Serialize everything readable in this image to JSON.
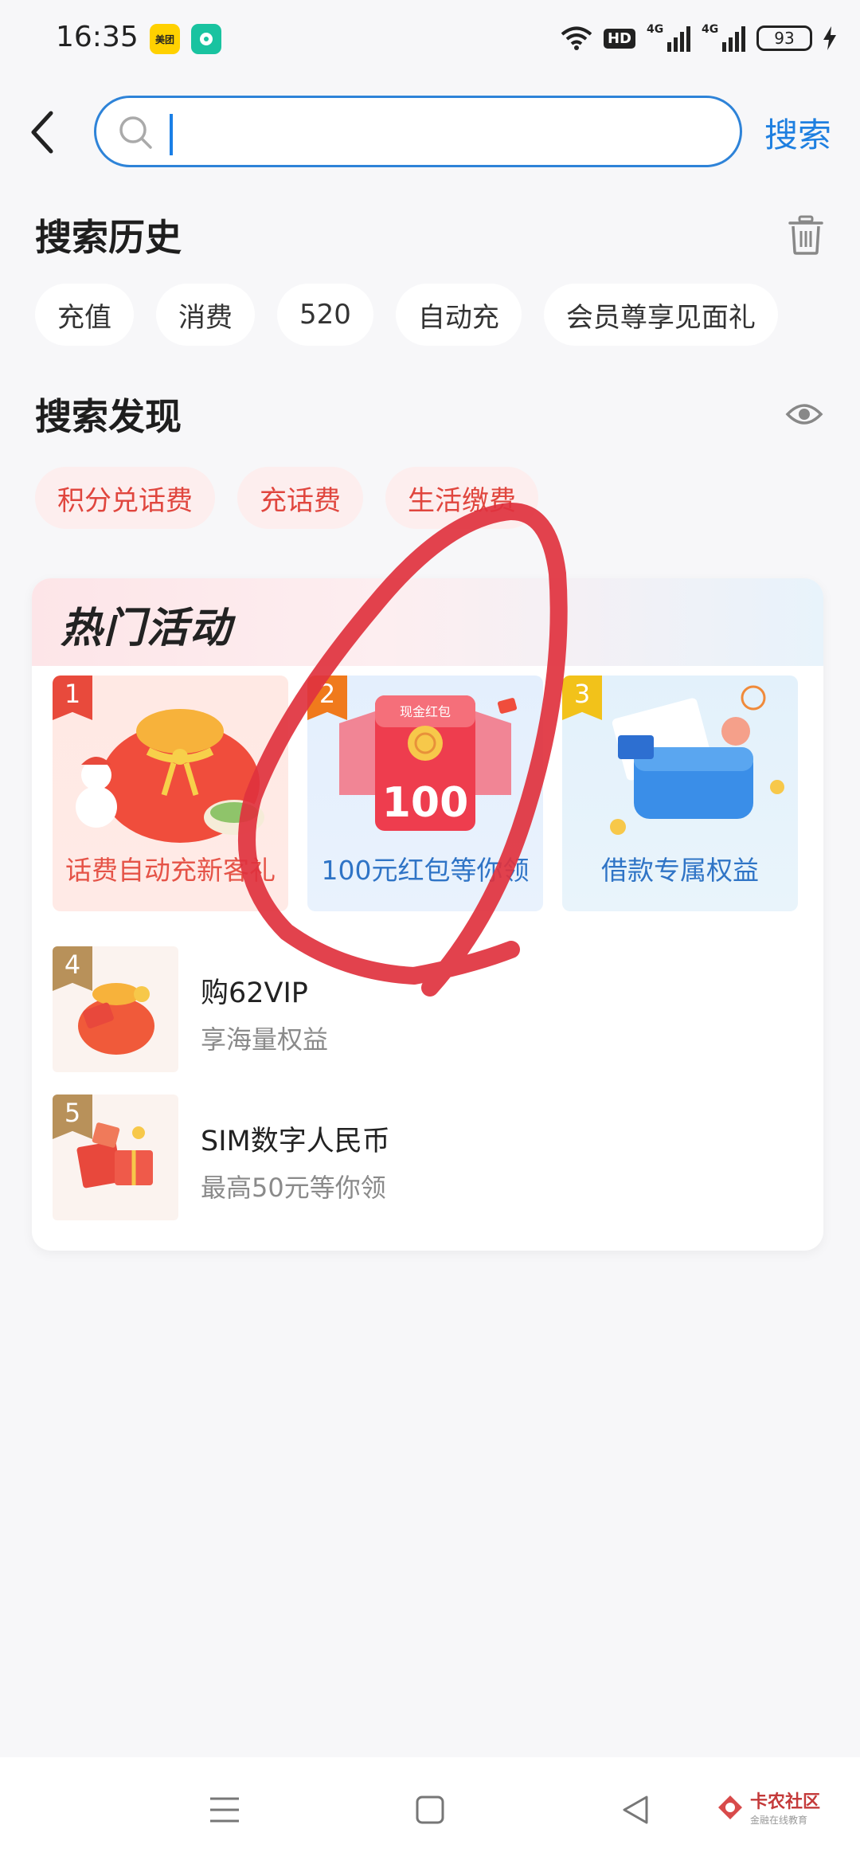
{
  "status_bar": {
    "time": "16:35",
    "app_icons": [
      "美团",
      "chat"
    ],
    "hd_label": "HD",
    "network_1": "4G",
    "network_2": "4G",
    "battery": "93"
  },
  "search": {
    "value": "",
    "button_label": "搜索"
  },
  "history": {
    "title": "搜索历史",
    "items": [
      "充值",
      "消费",
      "520",
      "自动充",
      "会员尊享见面礼"
    ]
  },
  "discover": {
    "title": "搜索发现",
    "items": [
      "积分兑话费",
      "充话费",
      "生活缴费"
    ]
  },
  "hot": {
    "title": "热门活动",
    "tiles": [
      {
        "rank": "1",
        "label": "话费自动充新客礼"
      },
      {
        "rank": "2",
        "label": "100元红包等你领",
        "art_top": "现金红包",
        "art_amount": "100"
      },
      {
        "rank": "3",
        "label": "借款专属权益"
      }
    ],
    "list": [
      {
        "rank": "4",
        "title": "购62VIP",
        "subtitle": "享海量权益"
      },
      {
        "rank": "5",
        "title": "SIM数字人民币",
        "subtitle": "最高50元等你领"
      }
    ]
  },
  "watermark": {
    "title": "卡农社区",
    "subtitle": "金融在线教育"
  },
  "colors": {
    "accent": "#1e7fe0",
    "hot_text": "#e0463e",
    "annotation": "#e0323e"
  }
}
